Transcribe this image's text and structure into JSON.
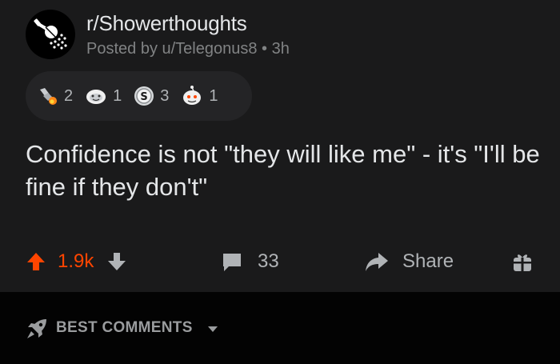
{
  "post": {
    "subreddit": "r/Showerthoughts",
    "meta": "Posted by u/Telegonus8 • 3h",
    "title": "Confidence is not \"they will like me\" - it's \"I'll be fine if they don't\"",
    "awards": [
      {
        "icon": "rocket-like-award-icon",
        "count": "2"
      },
      {
        "icon": "wholesome-award-icon",
        "count": "1"
      },
      {
        "icon": "silver-coin-award-icon",
        "count": "3"
      },
      {
        "icon": "snoo-award-icon",
        "count": "1"
      }
    ]
  },
  "actions": {
    "votes": "1.9k",
    "comments": "33",
    "share": "Share"
  },
  "sort": {
    "label": "BEST COMMENTS"
  },
  "colors": {
    "background": "#1a1a1b",
    "sortbar": "#030303",
    "upvote": "#ff4500",
    "muted": "#818384"
  }
}
